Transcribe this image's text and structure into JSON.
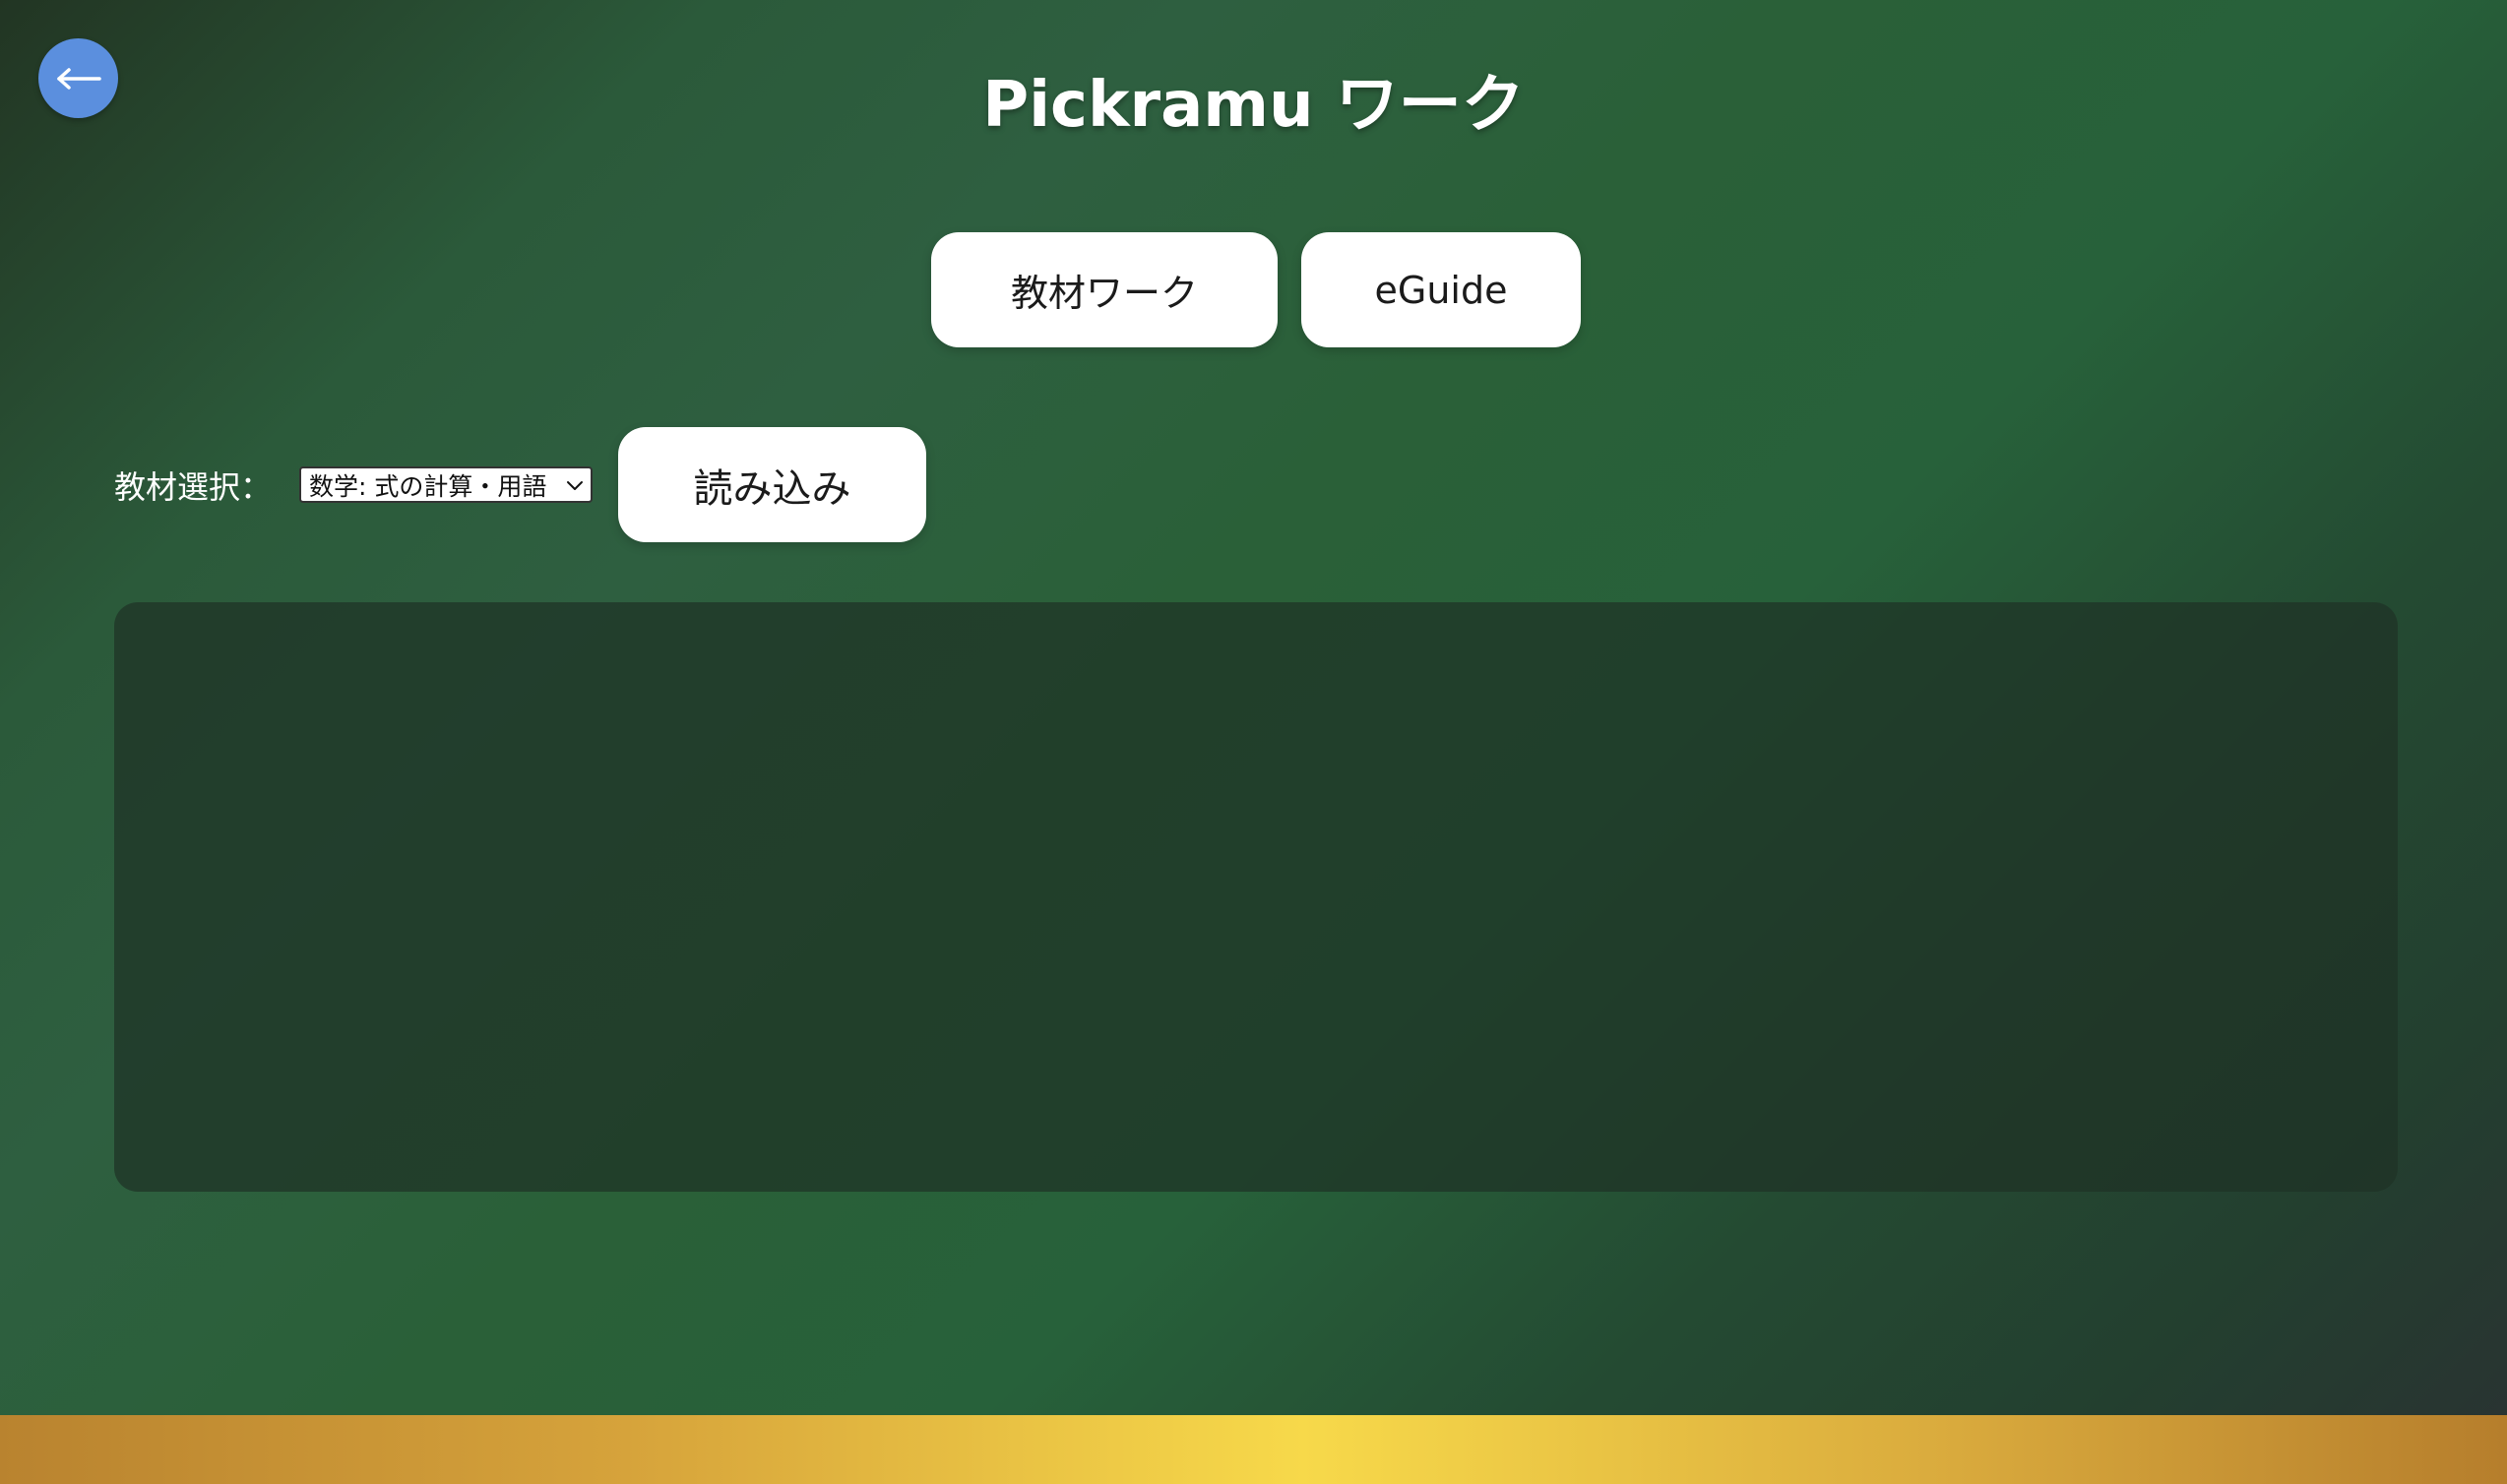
{
  "header": {
    "back_icon": "arrow-left-icon",
    "title": "Pickramu ワーク"
  },
  "tabs": [
    {
      "label": "教材ワーク"
    },
    {
      "label": "eGuide"
    }
  ],
  "selector": {
    "label": "教材選択：",
    "selected": "数学: 式の計算・用語",
    "dropdown_icon": "chevron-down-icon",
    "load_label": "読み込み"
  },
  "content": {},
  "colors": {
    "back_button": "#5b8fde",
    "background_dark": "#223523",
    "background_green": "#2a6038",
    "bottom_bar_gold": "#f7d94a",
    "panel": "#213b2d"
  }
}
